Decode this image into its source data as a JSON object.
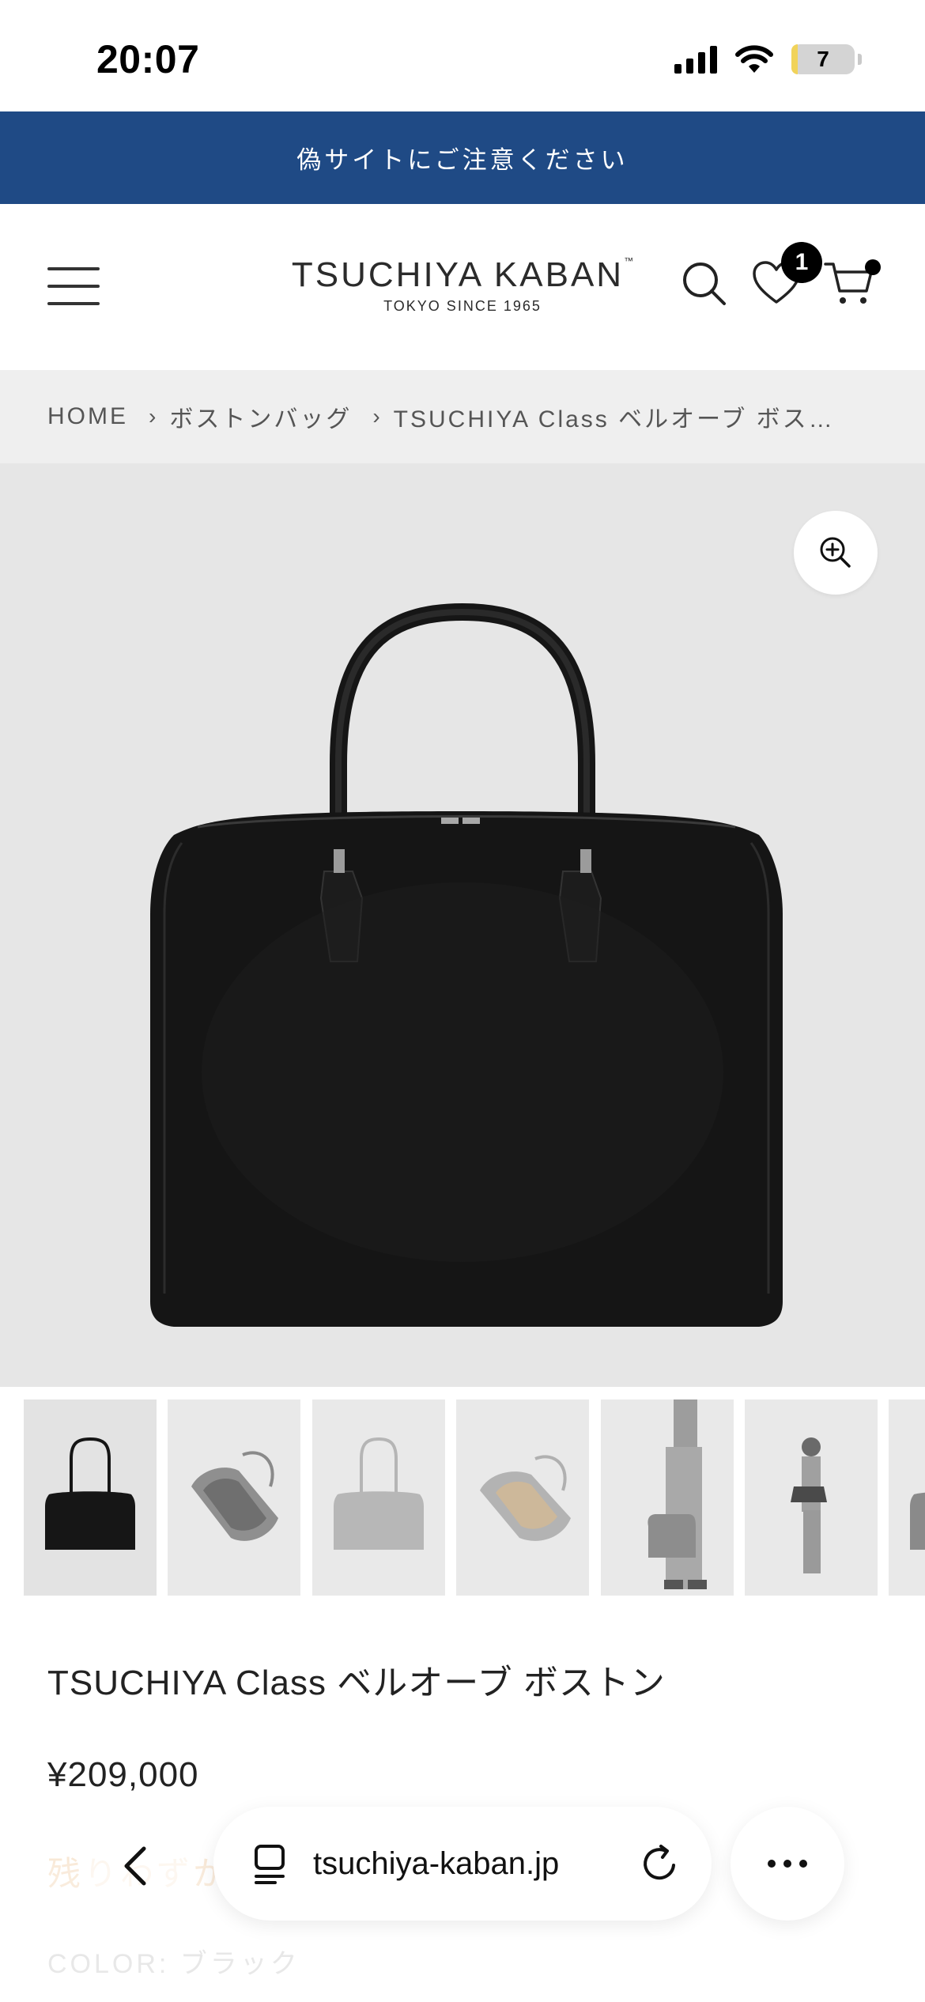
{
  "status_bar": {
    "time": "20:07",
    "battery": "7"
  },
  "notice_banner": {
    "text": "偽サイトにご注意ください"
  },
  "header": {
    "logo_main": "TSUCHIYA KABAN",
    "logo_tm": "™",
    "logo_sub": "TOKYO  SINCE 1965",
    "wishlist_count": "1",
    "icons": [
      "menu-icon",
      "search-icon",
      "heart-icon",
      "cart-icon"
    ]
  },
  "breadcrumb": {
    "items": [
      "HOME",
      "ボストンバッグ",
      "TSUCHIYA Class ベルオーブ ボストン"
    ],
    "separator": "›"
  },
  "product": {
    "title": "TSUCHIYA Class ベルオーブ ボストン",
    "price": "¥209,000",
    "stock_text": "残りわずか",
    "stock_visible": "残り",
    "color_label": "COLOR: ブラック",
    "thumbnails": [
      "black-bag",
      "grey-bag-open",
      "grey-bag",
      "grey-bag-open-interior",
      "model-with-bag",
      "model-carrying-bag",
      "grey-bag-partial"
    ]
  },
  "browser": {
    "url": "tsuchiya-kaban.jp"
  },
  "colors": {
    "notice_bg": "#1f4a85",
    "breadcrumb_bg": "#efefef",
    "image_bg": "#e6e6e6",
    "stock_color": "#e8b070"
  }
}
